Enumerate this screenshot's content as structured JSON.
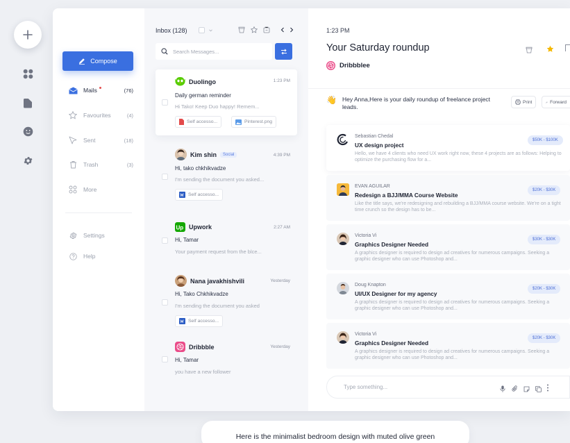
{
  "rail": {
    "icons": [
      "plus-icon",
      "grid-icon",
      "folder-icon",
      "smiley-icon",
      "gear-icon"
    ]
  },
  "nav": {
    "compose_label": "Compose",
    "items": [
      {
        "label": "Mails",
        "count": "(76)",
        "icon": "mail-icon",
        "active": true
      },
      {
        "label": "Favourites",
        "count": "(4)",
        "icon": "star-icon"
      },
      {
        "label": "Sent",
        "count": "(18)",
        "icon": "send-icon"
      },
      {
        "label": "Trash",
        "count": "(3)",
        "icon": "trash-icon"
      },
      {
        "label": "More",
        "count": "",
        "icon": "more-icon"
      }
    ],
    "settings_label": "Settings",
    "help_label": "Help"
  },
  "list": {
    "title": "Inbox (128)",
    "search_placeholder": "Search Messages...",
    "messages": [
      {
        "sender": "Duolingo",
        "time": "1:23 PM",
        "subject": "Daily german reminder",
        "preview": "Hi Tako! Keep Duo happy! Remem...",
        "attachments": [
          "Self accesso...",
          "Pinterest.png"
        ]
      },
      {
        "sender": "Kim shin",
        "badge": "Social",
        "time": "4:39 PM",
        "subject": "Hi, tako chkhikvadze",
        "preview": "I'm sending the document you asked...",
        "attachments": [
          "Self accesso..."
        ]
      },
      {
        "sender": "Upwork",
        "time": "2:27 AM",
        "subject": "Hi, Tamar",
        "preview": "Your payment request from the blce...",
        "attachments": []
      },
      {
        "sender": "Nana javakhishvili",
        "time": "Yesterday",
        "subject": "Hi, Tako Chkhikvadze",
        "preview": "I'm sending the document you asked",
        "attachments": [
          "Self accesso..."
        ]
      },
      {
        "sender": "Dribbble",
        "time": "Yesterday",
        "subject": "Hi, Tamar",
        "preview": "you have a new follower",
        "attachments": []
      }
    ]
  },
  "reader": {
    "time": "1:23 PM",
    "title": "Your Saturday roundup",
    "from": "Dribbblee",
    "greeting": "Hey Anna,Here is your daily roundup of freelance project leads.",
    "print_label": "Print",
    "forward_label": "Forward",
    "jobs": [
      {
        "name": "Sebastian Chedal",
        "title": "UX design project",
        "desc": "Hello, we have 4 clients who need UX work right now, these 4 projects are as follows: Helping to optimize the purchasing flow for a...",
        "salary": "$50K - $100K"
      },
      {
        "name": "EVAN AGUILAR",
        "title": "Redesign a BJJ/MMA Course Website",
        "desc": "Like the title says, we're redesigning and rebuilding a BJJ/MMA course website. We're on a tight time crunch so the design has to be...",
        "salary": "$20K - $30K"
      },
      {
        "name": "Victoria Vi",
        "title": "Graphics Designer Needed",
        "desc": "A graphics designer is required to design ad creatives for numerous campaigns. Seeking a graphic designer who can use Photoshop and...",
        "salary": "$30K - $30K"
      },
      {
        "name": "Doug Knapton",
        "title": "UI/UX Designer for my agency",
        "desc": "A graphics designer is required to design ad creatives for numerous campaigns. Seeking a graphic designer who can use Photoshop and...",
        "salary": "$20K - $30K"
      },
      {
        "name": "Victoria Vi",
        "title": "Graphics Designer Needed",
        "desc": "A graphics designer is required to design ad creatives for numerous campaigns. Seeking a graphic designer who can use Photoshop and...",
        "salary": "$20K - $30K"
      }
    ],
    "composer_placeholder": "Type something..."
  },
  "bubble": {
    "text": "Here is the minimalist bedroom design with muted olive green"
  },
  "colors": {
    "accent": "#3a6fe0",
    "star": "#f5b800",
    "dribbble": "#ea4c89",
    "upwork": "#14a800",
    "duolingo": "#58cc02"
  }
}
